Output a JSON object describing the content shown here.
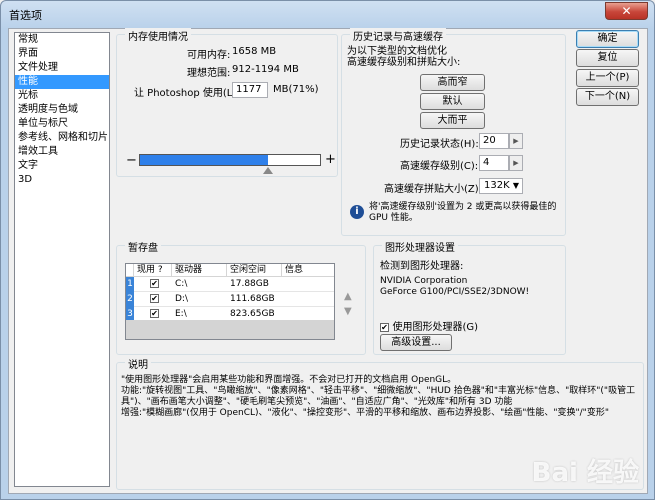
{
  "window": {
    "title": "首选项",
    "close": "✕"
  },
  "nav": {
    "items": [
      "常规",
      "界面",
      "文件处理",
      "性能",
      "光标",
      "透明度与色域",
      "单位与标尺",
      "参考线、网格和切片",
      "增效工具",
      "文字",
      "3D"
    ],
    "selected_index": 3
  },
  "memory": {
    "legend": "内存使用情况",
    "available_label": "可用内存:",
    "available_value": "1658 MB",
    "ideal_label": "理想范围:",
    "ideal_value": "912-1194 MB",
    "photoshop_label": "让 Photoshop 使用(L):",
    "photoshop_value": "1177",
    "photoshop_unit": "MB(71%)",
    "minus": "−",
    "plus": "+",
    "slider_percent": 71
  },
  "history": {
    "legend": "历史记录与高速缓存",
    "intro": "为以下类型的文档优化\n高速缓存级别和拼贴大小:",
    "buttons": [
      "高而窄",
      "默认",
      "大而平"
    ],
    "states_label": "历史记录状态(H):",
    "states_value": "20",
    "cache_levels_label": "高速缓存级别(C):",
    "cache_levels_value": "4",
    "tile_size_label": "高速缓存拼贴大小(Z):",
    "tile_size_value": "132K",
    "info_icon": "info-icon",
    "info_text": "将'高速缓存级别'设置为 2 或更高以获得最佳的 GPU 性能。"
  },
  "scratch": {
    "legend": "暂存盘",
    "columns": [
      "现用 ?",
      "驱动器",
      "空闲空间",
      "信息"
    ],
    "rows": [
      {
        "num": "1",
        "active": true,
        "drive": "C:\\",
        "free": "17.88GB",
        "info": ""
      },
      {
        "num": "2",
        "active": true,
        "drive": "D:\\",
        "free": "111.68GB",
        "info": ""
      },
      {
        "num": "3",
        "active": true,
        "drive": "E:\\",
        "free": "823.65GB",
        "info": ""
      }
    ],
    "up_arrow": "▲",
    "down_arrow": "▼"
  },
  "gpu": {
    "legend": "图形处理器设置",
    "detected_label": "检测到图形处理器:",
    "vendor": "NVIDIA Corporation",
    "model": "GeForce G100/PCI/SSE2/3DNOW!",
    "use_gpu_label": "使用图形处理器(G)",
    "use_gpu_checked": true,
    "advanced_button": "高级设置..."
  },
  "description": {
    "legend": "说明",
    "text": "\"使用图形处理器\"会启用某些功能和界面增强。不会对已打开的文档启用 OpenGL。\n功能:\"旋转视图\"工具、\"鸟瞰缩放\"、\"像素网格\"、\"轻击平移\"、\"细微缩放\"、\"HUD 拾色器\"和\"丰富光标\"信息、\"取样环\"(\"吸管工具\")、\"画布画笔大小调整\"、\"硬毛刷笔尖预览\"、\"油画\"、\"自适应广角\"、\"光效库\"和所有 3D 功能\n增强:\"模糊画廊\"(仅用于 OpenCL)、\"液化\"、\"操控变形\"、平滑的平移和缩放、画布边界投影、\"绘画\"性能、\"变换\"/\"变形\""
  },
  "actions": {
    "ok": "确定",
    "reset": "复位",
    "prev": "上一个(P)",
    "next": "下一个(N)"
  },
  "watermark": "Bai 经验"
}
